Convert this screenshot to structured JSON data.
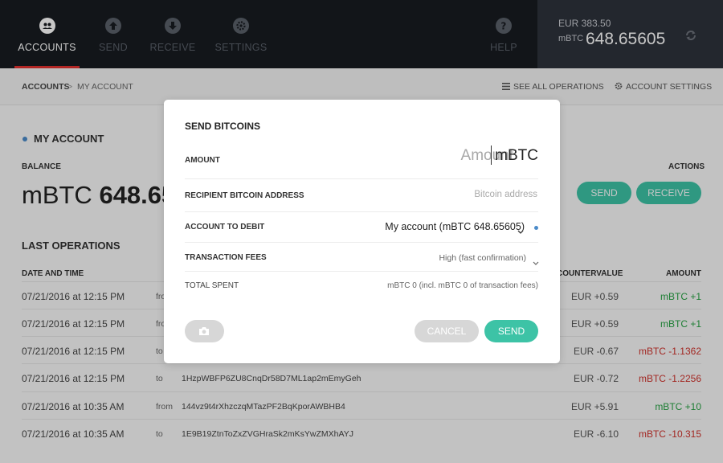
{
  "nav": {
    "accounts": "ACCOUNTS",
    "send": "SEND",
    "receive": "RECEIVE",
    "settings": "SETTINGS",
    "help": "HELP"
  },
  "balance_panel": {
    "eur": "EUR 383.50",
    "unit": "mBTC",
    "value": "648.65605"
  },
  "breadcrumb": {
    "root": "ACCOUNTS",
    "separator": ">",
    "current": "MY ACCOUNT",
    "see_all": "SEE ALL OPERATIONS",
    "account_settings": "ACCOUNT SETTINGS"
  },
  "account": {
    "title": "MY ACCOUNT",
    "balance_label": "BALANCE",
    "balance_unit": "mBTC",
    "balance_value": "648.65",
    "actions_label": "ACTIONS",
    "send_label": "SEND",
    "receive_label": "RECEIVE"
  },
  "operations": {
    "title": "LAST OPERATIONS",
    "headers": {
      "date": "DATE AND TIME",
      "countervalue": "COUNTERVALUE",
      "amount": "AMOUNT"
    },
    "rows": [
      {
        "date": "07/21/2016 at 12:15 PM",
        "dir": "from",
        "address": "",
        "cv": "EUR +0.59",
        "amount": "mBTC +1",
        "sign": "pos"
      },
      {
        "date": "07/21/2016 at 12:15 PM",
        "dir": "from",
        "address": "",
        "cv": "EUR +0.59",
        "amount": "mBTC +1",
        "sign": "pos"
      },
      {
        "date": "07/21/2016 at 12:15 PM",
        "dir": "to",
        "address": "",
        "cv": "EUR -0.67",
        "amount": "mBTC -1.1362",
        "sign": "neg"
      },
      {
        "date": "07/21/2016 at 12:15 PM",
        "dir": "to",
        "address": "1HzpWBFP6ZU8CnqDr58D7ML1ap2mEmyGeh",
        "cv": "EUR -0.72",
        "amount": "mBTC -1.2256",
        "sign": "neg"
      },
      {
        "date": "07/21/2016 at 10:35 AM",
        "dir": "from",
        "address": "144vz9t4rXhzczqMTazPF2BqKporAWBHB4",
        "cv": "EUR +5.91",
        "amount": "mBTC +10",
        "sign": "pos"
      },
      {
        "date": "07/21/2016 at 10:35 AM",
        "dir": "to",
        "address": "1E9B19ZtnToZxZVGHraSk2mKsYwZMXhAYJ",
        "cv": "EUR -6.10",
        "amount": "mBTC -10.315",
        "sign": "neg"
      }
    ]
  },
  "modal": {
    "title": "SEND BITCOINS",
    "amount_label": "AMOUNT",
    "amount_placeholder": "Amount",
    "amount_unit": "mBTC",
    "recipient_label": "RECIPIENT BITCOIN ADDRESS",
    "recipient_placeholder": "Bitcoin address",
    "debit_label": "ACCOUNT TO DEBIT",
    "debit_value": "My account (mBTC 648.65605)",
    "fees_label": "TRANSACTION FEES",
    "fees_value": "High (fast confirmation)",
    "total_label": "TOTAL SPENT",
    "total_value": "mBTC 0 (incl. mBTC 0 of transaction fees)",
    "cancel_label": "CANCEL",
    "send_label": "SEND"
  },
  "icons": {
    "accounts": "accounts-icon",
    "send": "send-arrow-icon",
    "receive": "receive-arrow-icon",
    "settings": "gear-icon",
    "help": "help-icon",
    "sync": "sync-icon",
    "list": "list-icon",
    "camera": "camera-icon",
    "chevron": "chevron-down-icon"
  },
  "colors": {
    "accent": "#3dc3a6",
    "active_tab": "#e4312f",
    "positive": "#27a243",
    "negative": "#d0322c",
    "topbar": "#181b20"
  }
}
